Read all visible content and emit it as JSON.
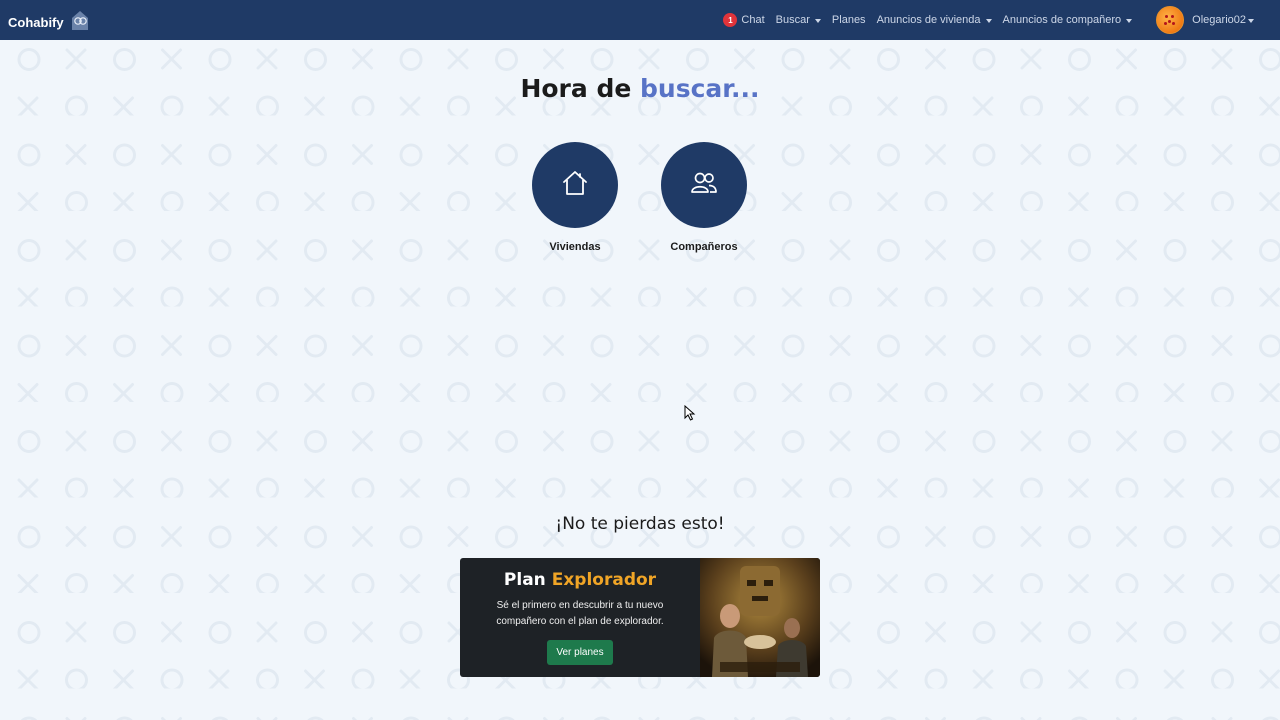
{
  "navbar": {
    "brand": "Cohabify",
    "chat_badge": "1",
    "chat": "Chat",
    "buscar": "Buscar",
    "planes": "Planes",
    "anuncios_vivienda": "Anuncios de vivienda",
    "anuncios_companero": "Anuncios de compañero",
    "username": "Olegario02"
  },
  "main": {
    "title_prefix": "Hora de",
    "title_accent": "buscar...",
    "options": [
      {
        "label": "Viviendas",
        "icon": "house-icon"
      },
      {
        "label": "Compañeros",
        "icon": "people-icon"
      }
    ]
  },
  "promo": {
    "heading": "¡No te pierdas esto!",
    "title_prefix": "Plan",
    "title_accent": "Explorador",
    "description": "Sé el primero en descubrir a tu nuevo compañero con el plan de explorador.",
    "button": "Ver planes"
  },
  "colors": {
    "navbar": "#1f3a66",
    "accent": "#5873c6",
    "gold": "#f0a526",
    "button_green": "#1e7a4c",
    "badge_red": "#e0343b"
  }
}
